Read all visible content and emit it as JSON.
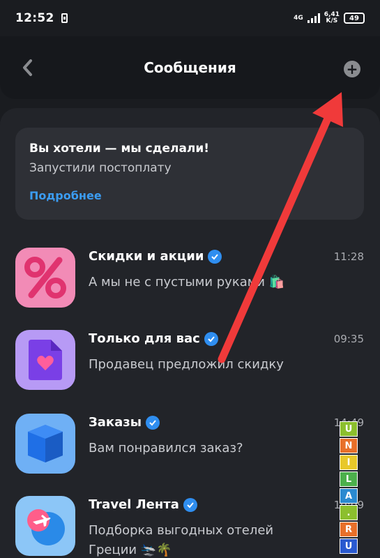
{
  "status_bar": {
    "time": "12:52",
    "network": "4G",
    "speed_value": "6,41",
    "speed_unit": "K/S",
    "battery": "49"
  },
  "header": {
    "title": "Сообщения",
    "back_icon": "chevron-left-icon",
    "action_icon": "plus-icon"
  },
  "promo": {
    "title": "Вы хотели — мы сделали!",
    "subtitle": "Запустили постоплату",
    "link": "Подробнее"
  },
  "chats": [
    {
      "name": "Скидки и акции",
      "time": "11:28",
      "preview": "А мы не с пустыми руками 🛍️",
      "icon": "percent-icon",
      "color": "#f06aa0"
    },
    {
      "name": "Только для вас",
      "time": "09:35",
      "preview": "Продавец предложил скидку",
      "icon": "heart-document-icon",
      "color": "#9b5cf0"
    },
    {
      "name": "Заказы",
      "time": "14:49",
      "preview": "Вам понравился заказ?",
      "icon": "box-icon",
      "color": "#2e7df0"
    },
    {
      "name": "Travel Лента",
      "time": "10:09",
      "preview": "Подборка выгодных отелей Греции 🛬🌴",
      "icon": "airplane-globe-icon",
      "color": "#3ea0f0"
    }
  ],
  "watermark": [
    "U",
    "N",
    "I",
    "L",
    "A",
    ".",
    "R",
    "U"
  ],
  "colors": {
    "background": "#1a1c20",
    "panel": "#222429",
    "accent_link": "#3b9cf2",
    "verified": "#2f8ef0",
    "annotation_arrow": "#f03a3a"
  }
}
